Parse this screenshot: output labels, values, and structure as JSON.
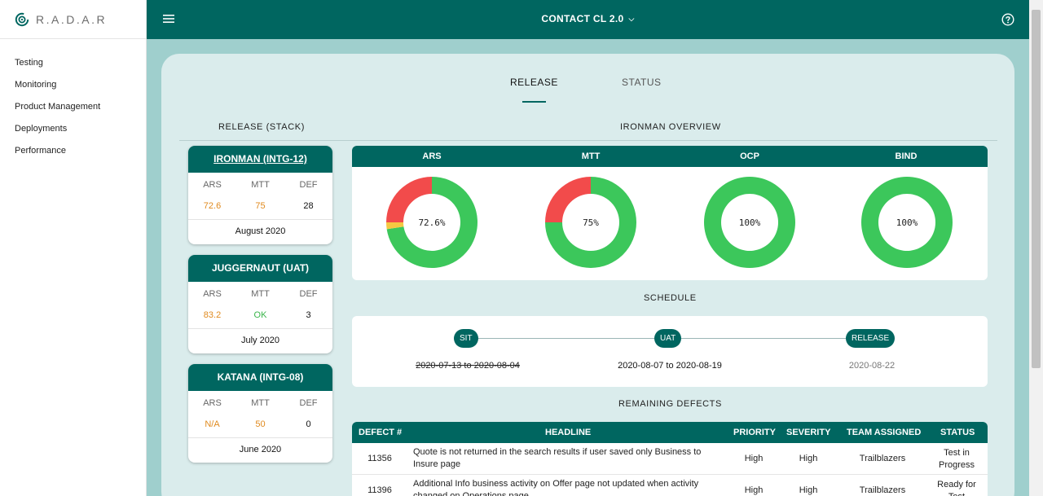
{
  "brand": {
    "name": "R.A.D.A.R"
  },
  "sidebar": {
    "items": [
      {
        "label": "Testing"
      },
      {
        "label": "Monitoring"
      },
      {
        "label": "Product Management"
      },
      {
        "label": "Deployments"
      },
      {
        "label": "Performance"
      }
    ]
  },
  "header": {
    "title": "CONTACT CL 2.0"
  },
  "tabs": [
    {
      "label": "RELEASE",
      "active": true
    },
    {
      "label": "STATUS",
      "active": false
    }
  ],
  "release_stack": {
    "title": "RELEASE (STACK)",
    "columns": [
      "ARS",
      "MTT",
      "DEF"
    ],
    "cards": [
      {
        "name": "IRONMAN (INTG-12)",
        "ars": "72.6",
        "mtt": "75",
        "def": "28",
        "date": "August 2020"
      },
      {
        "name": "JUGGERNAUT (UAT)",
        "ars": "83.2",
        "mtt": "OK",
        "def": "3",
        "date": "July 2020"
      },
      {
        "name": "KATANA (INTG-08)",
        "ars": "N/A",
        "mtt": "50",
        "def": "0",
        "date": "June 2020"
      }
    ]
  },
  "overview": {
    "title": "IRONMAN OVERVIEW",
    "metrics": [
      {
        "label": "ARS",
        "value_text": "72.6%",
        "green": 72.6,
        "yellow": 2.4,
        "red": 25
      },
      {
        "label": "MTT",
        "value_text": "75%",
        "green": 75,
        "yellow": 0,
        "red": 25
      },
      {
        "label": "OCP",
        "value_text": "100%",
        "green": 100,
        "yellow": 0,
        "red": 0
      },
      {
        "label": "BIND",
        "value_text": "100%",
        "green": 100,
        "yellow": 0,
        "red": 0
      }
    ],
    "colors": {
      "green": "#3cc75b",
      "red": "#f24b4b",
      "yellow": "#f5c842"
    }
  },
  "schedule": {
    "title": "SCHEDULE",
    "milestones": [
      {
        "label": "SIT",
        "date": "2020-07-13 to 2020-08-04",
        "state": "done"
      },
      {
        "label": "UAT",
        "date": "2020-08-07 to 2020-08-19",
        "state": "active"
      },
      {
        "label": "RELEASE",
        "date": "2020-08-22",
        "state": "future"
      }
    ]
  },
  "defects": {
    "title": "REMAINING DEFECTS",
    "columns": [
      "DEFECT #",
      "HEADLINE",
      "PRIORITY",
      "SEVERITY",
      "TEAM ASSIGNED",
      "STATUS"
    ],
    "rows": [
      {
        "id": "11356",
        "headline": "Quote is not returned in the search results if user saved only Business to Insure page",
        "priority": "High",
        "severity": "High",
        "team": "Trailblazers",
        "status": "Test in Progress"
      },
      {
        "id": "11396",
        "headline": "Additional Info business activity on Offer page not updated when activity changed on Operations page",
        "priority": "High",
        "severity": "High",
        "team": "Trailblazers",
        "status": "Ready for Test"
      }
    ]
  },
  "accent_color": "#006660"
}
